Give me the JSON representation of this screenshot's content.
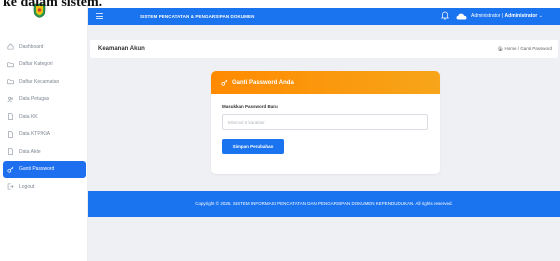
{
  "bleed_text": "ke dalam sistem.",
  "sidebar": {
    "items": [
      {
        "label": "Dashboard",
        "icon": "home-icon",
        "active": false
      },
      {
        "label": "Daftar Kategori",
        "icon": "folder-icon",
        "active": false
      },
      {
        "label": "Daftar Kecamatan",
        "icon": "folder-icon",
        "active": false
      },
      {
        "label": "Data Petugas",
        "icon": "users-icon",
        "active": false
      },
      {
        "label": "Data KK",
        "icon": "document-icon",
        "active": false
      },
      {
        "label": "Data KTP/KIA",
        "icon": "document-icon",
        "active": false
      },
      {
        "label": "Data Akte",
        "icon": "document-icon",
        "active": false
      },
      {
        "label": "Ganti Password",
        "icon": "key-icon",
        "active": true
      },
      {
        "label": "Logout",
        "icon": "logout-icon",
        "active": false
      }
    ]
  },
  "topbar": {
    "title": "SISTEM PENCATATAN & PENGARSIPAN DOKUMEN",
    "role": "Administrator",
    "username": "Administrator"
  },
  "page": {
    "title": "Keamanan Akun",
    "breadcrumb": "Home / Ganti Password"
  },
  "card": {
    "title": "Ganti Password Anda",
    "field_label": "Masukkan Password Baru",
    "placeholder": "Minimal 6 karakter",
    "button": "Simpan Perubahan"
  },
  "footer": {
    "text": "Copyright © 2025. SISTEM INFORMASI PENCATATAN DAN PENGARSIPAN DOKUMEN KEPENDUDUKAN. All rights reserved."
  },
  "colors": {
    "primary": "#1a73ef",
    "card_header": "#ff8a00"
  }
}
